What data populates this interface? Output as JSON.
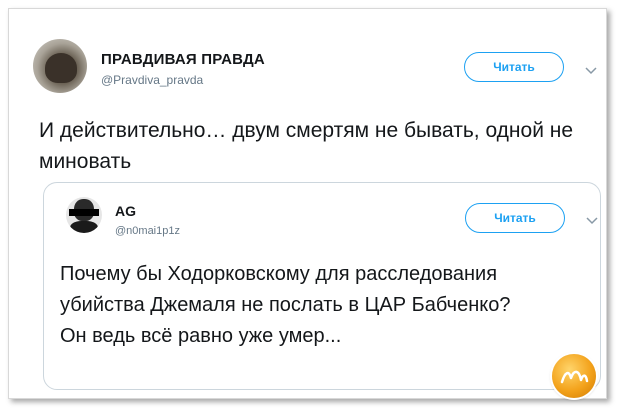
{
  "tweet": {
    "author_name": "ПРАВДИВАЯ ПРАВДА",
    "author_handle": "@Pravdiva_pravda",
    "follow_label": "Читать",
    "text": "И действительно… двум смертям не бывать, одной не миновать"
  },
  "quoted_tweet": {
    "author_name": "AG",
    "author_handle": "@n0mai1p1z",
    "follow_label": "Читать",
    "text": "Почему бы Ходорковскому для расследования убийства Джемаля не послать в ЦАР Бабченко? Он ведь всё равно уже умер..."
  },
  "icons": {
    "menu": "chevron-down-icon",
    "watermark": "nyka-logo"
  },
  "colors": {
    "accent": "#1da1f2",
    "text": "#14171a",
    "muted": "#657786",
    "border": "#ccd6dd"
  }
}
